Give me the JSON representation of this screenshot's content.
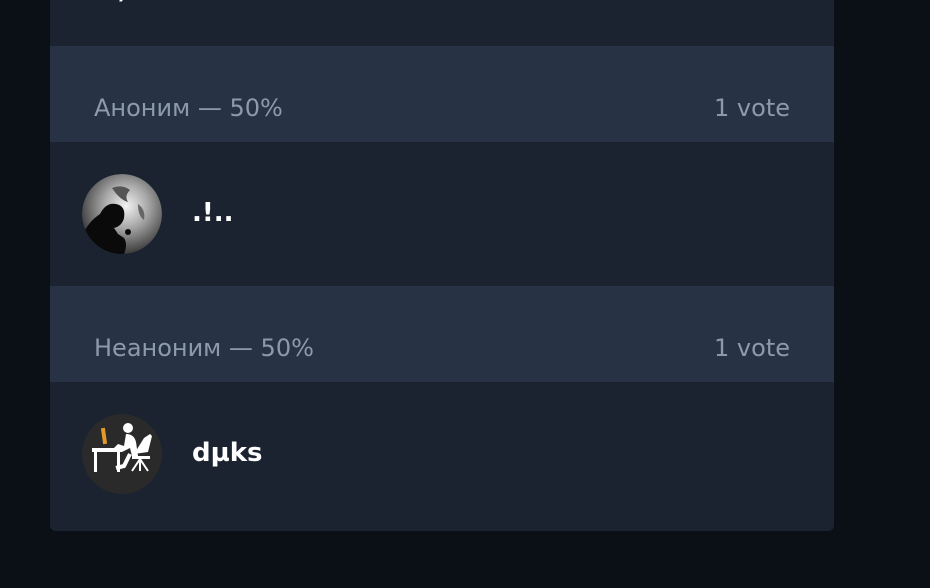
{
  "poll": {
    "top_partial_text": "…, …",
    "options": [
      {
        "label": "Аноним — 50%",
        "votes": "1 vote",
        "voters": [
          {
            "name": ".!..",
            "avatar": "earth-silhouette-avatar"
          }
        ]
      },
      {
        "label": "Неаноним — 50%",
        "votes": "1 vote",
        "voters": [
          {
            "name": "dµks",
            "avatar": "desk-worker-avatar"
          }
        ]
      }
    ]
  },
  "colors": {
    "background": "#0b0f16",
    "panel": "#1b2331",
    "option_header": "#273345",
    "muted_text": "#8d9aac",
    "name_text": "#ffffff"
  }
}
